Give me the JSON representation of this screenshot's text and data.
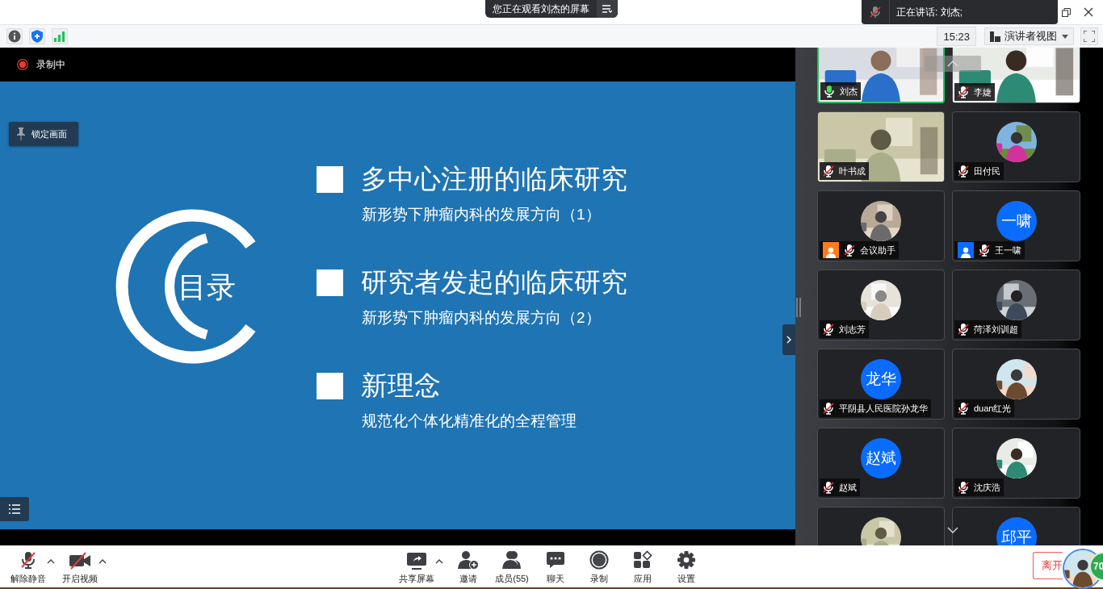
{
  "top_bar": {
    "viewing_notice": "您正在观看刘杰的屏幕",
    "speaking_label": "正在讲话: 刘杰;"
  },
  "toolbar": {
    "time": "15:23",
    "view_mode": "演讲者视图"
  },
  "share": {
    "recording_label": "录制中",
    "lock_button": "锁定画面",
    "slide": {
      "title": "目录",
      "items": [
        {
          "heading": "多中心注册的临床研究",
          "subtitle": "新形势下肿瘤内科的发展方向（1）"
        },
        {
          "heading": "研究者发起的临床研究",
          "subtitle": "新形势下肿瘤内科的发展方向（2）"
        },
        {
          "heading": "新理念",
          "subtitle": "规范化个体化精准化的全程管理"
        }
      ]
    }
  },
  "participants": [
    {
      "name": "刘杰",
      "muted": false,
      "speaking": true,
      "avatar": {
        "kind": "video"
      }
    },
    {
      "name": "李婕",
      "muted": true,
      "speaking": false,
      "avatar": {
        "kind": "video"
      }
    },
    {
      "name": "叶书成",
      "muted": true,
      "speaking": false,
      "avatar": {
        "kind": "video"
      }
    },
    {
      "name": "田付民",
      "muted": true,
      "speaking": false
    },
    {
      "name": "会议助手",
      "muted": true,
      "speaking": false,
      "color": "#ff7a1a"
    },
    {
      "name": "王一啸",
      "muted": true,
      "speaking": false,
      "color": "#0a6cff",
      "avatar": {
        "kind": "initials",
        "text": "一啸"
      }
    },
    {
      "name": "刘志芳",
      "muted": true,
      "speaking": false
    },
    {
      "name": "菏泽刘训超",
      "muted": true,
      "speaking": false
    },
    {
      "name": "平阴县人民医院孙龙华",
      "muted": true,
      "speaking": false,
      "avatar": {
        "kind": "initials",
        "text": "龙华"
      }
    },
    {
      "name": "duan红光",
      "muted": true,
      "speaking": false
    },
    {
      "name": "赵斌",
      "muted": true,
      "speaking": false,
      "avatar": {
        "kind": "initials",
        "text": "赵斌"
      }
    },
    {
      "name": "沈庆浩",
      "muted": true,
      "speaking": false
    },
    {
      "speaking": false
    },
    {
      "speaking": false,
      "avatar": {
        "kind": "initials",
        "text": "邱平"
      }
    }
  ],
  "controls": [
    {
      "kind": "mic",
      "label": "解除静音",
      "caret": true
    },
    {
      "kind": "camera",
      "label": "开启视频",
      "caret": true
    },
    {
      "kind": "share",
      "label": "共享屏幕",
      "caret": true
    },
    {
      "kind": "invite",
      "label": "邀请",
      "caret": false
    },
    {
      "kind": "members",
      "label": "成员(55)",
      "caret": false
    },
    {
      "kind": "chat",
      "label": "聊天",
      "caret": false
    },
    {
      "kind": "record",
      "label": "录制",
      "caret": false
    },
    {
      "kind": "apps",
      "label": "应用",
      "caret": false
    },
    {
      "kind": "settings",
      "label": "设置",
      "caret": false
    }
  ],
  "leave_button": "离开",
  "badge": "70"
}
